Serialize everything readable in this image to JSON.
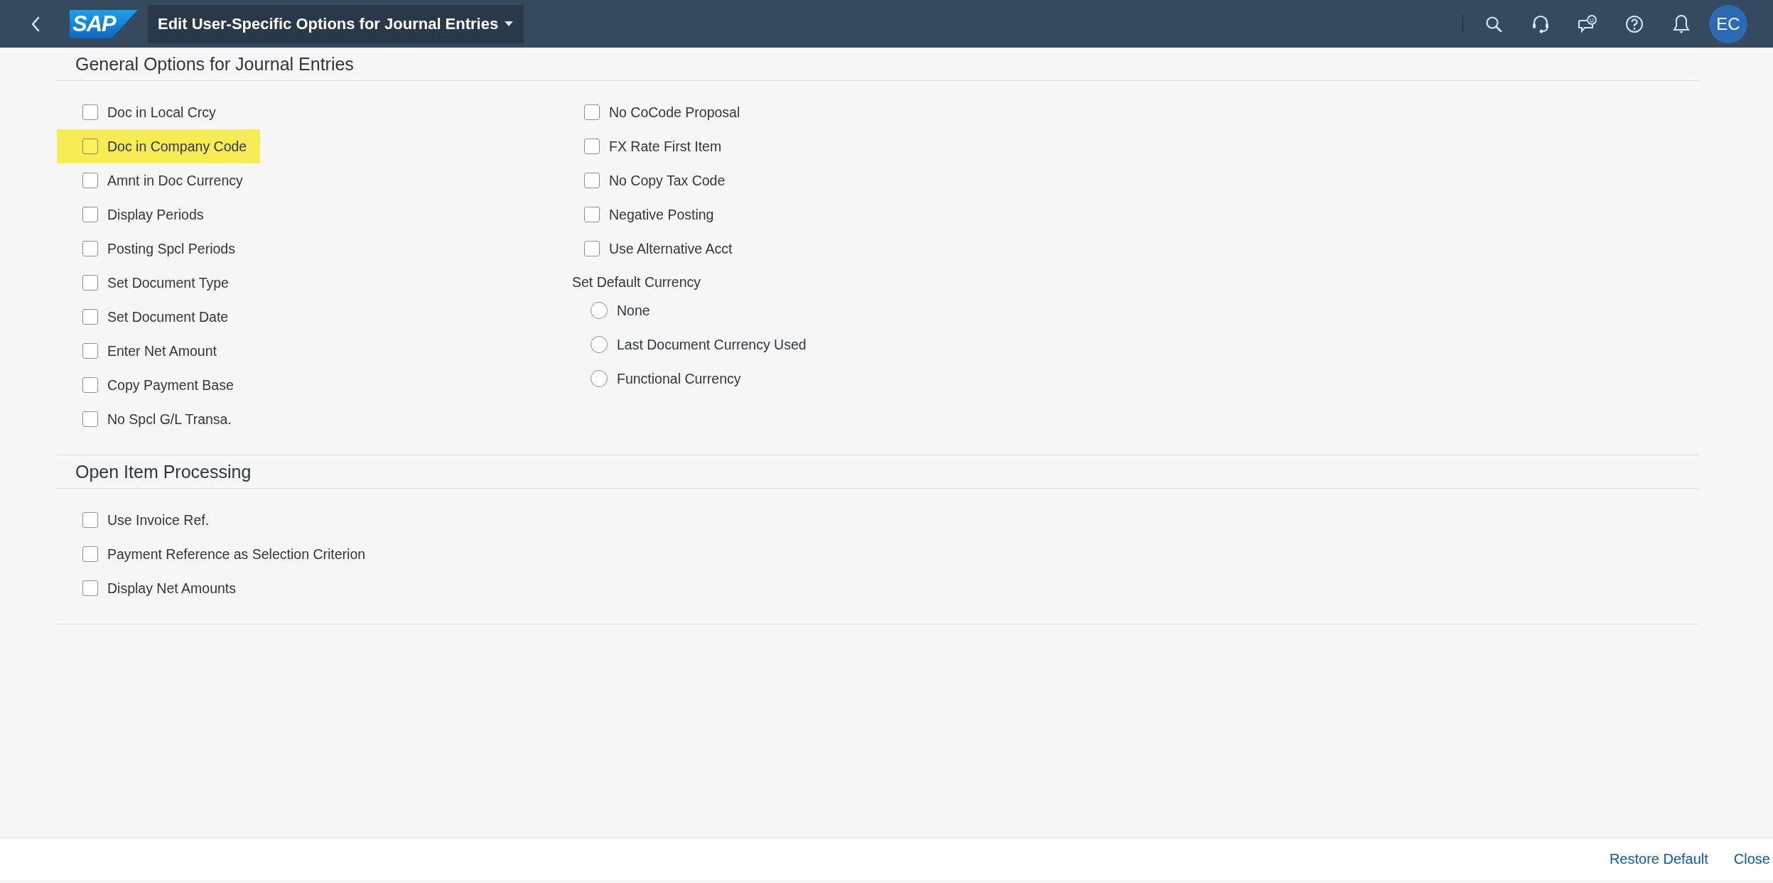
{
  "shell_bar": {
    "logo": "SAP",
    "title": "Edit User-Specific Options for Journal Entries",
    "avatar": "EC"
  },
  "sections": [
    {
      "title": "General Options for Journal Entries",
      "columns": [
        [
          {
            "kind": "checkbox",
            "label": "Doc in Local Crcy",
            "checked": false,
            "highlighted": false
          },
          {
            "kind": "checkbox",
            "label": "Doc in Company Code",
            "checked": false,
            "highlighted": true
          },
          {
            "kind": "checkbox",
            "label": "Amnt in Doc Currency",
            "checked": false,
            "highlighted": false
          },
          {
            "kind": "checkbox",
            "label": "Display Periods",
            "checked": false,
            "highlighted": false
          },
          {
            "kind": "checkbox",
            "label": "Posting Spcl Periods",
            "checked": false,
            "highlighted": false
          },
          {
            "kind": "checkbox",
            "label": "Set Document Type",
            "checked": false,
            "highlighted": false
          },
          {
            "kind": "checkbox",
            "label": "Set Document Date",
            "checked": false,
            "highlighted": false
          },
          {
            "kind": "checkbox",
            "label": "Enter Net Amount",
            "checked": false,
            "highlighted": false
          },
          {
            "kind": "checkbox",
            "label": "Copy Payment Base",
            "checked": false,
            "highlighted": false
          },
          {
            "kind": "checkbox",
            "label": "No Spcl G/L Transa.",
            "checked": false,
            "highlighted": false
          }
        ],
        [
          {
            "kind": "checkbox",
            "label": "No CoCode Proposal",
            "checked": false,
            "highlighted": false
          },
          {
            "kind": "checkbox",
            "label": "FX Rate First Item",
            "checked": false,
            "highlighted": false
          },
          {
            "kind": "checkbox",
            "label": "No Copy Tax Code",
            "checked": false,
            "highlighted": false
          },
          {
            "kind": "checkbox",
            "label": "Negative Posting",
            "checked": false,
            "highlighted": false
          },
          {
            "kind": "checkbox",
            "label": "Use Alternative Acct",
            "checked": false,
            "highlighted": false
          },
          {
            "kind": "group-label",
            "label": "Set Default Currency"
          },
          {
            "kind": "radio",
            "label": "None",
            "selected": false
          },
          {
            "kind": "radio",
            "label": "Last Document Currency Used",
            "selected": false
          },
          {
            "kind": "radio",
            "label": "Functional Currency",
            "selected": false
          }
        ]
      ]
    },
    {
      "title": "Open Item Processing",
      "columns": [
        [
          {
            "kind": "checkbox",
            "label": "Use Invoice Ref.",
            "checked": false,
            "highlighted": false
          },
          {
            "kind": "checkbox",
            "label": "Payment Reference as Selection Criterion",
            "checked": false,
            "highlighted": false
          },
          {
            "kind": "checkbox",
            "label": "Display Net Amounts",
            "checked": false,
            "highlighted": false
          }
        ]
      ]
    }
  ],
  "footer": {
    "buttons": [
      "Restore Default",
      "Close"
    ]
  }
}
